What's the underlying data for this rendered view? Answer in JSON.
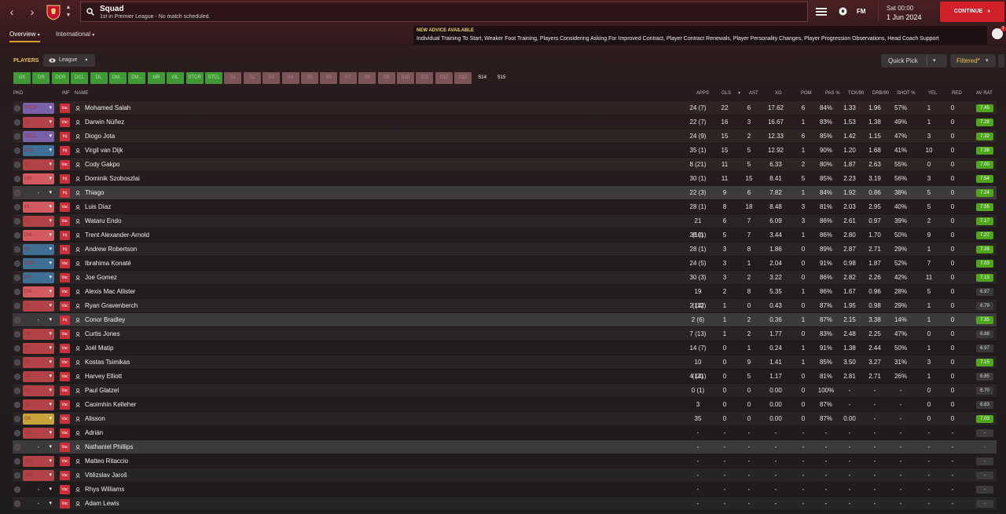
{
  "header": {
    "title": "Squad",
    "subtitle": "1st in Premier League - No match scheduled.",
    "fm_logo": "FM",
    "time": "Sat 00:00",
    "date": "1 Jun 2024",
    "continue_label": "CONTINUE"
  },
  "tabs": [
    {
      "label": "Overview"
    },
    {
      "label": "International"
    }
  ],
  "advice": {
    "heading": "NEW ADVICE AVAILABLE",
    "text": "Individual Training To Start, Weaker Foot Training, Players Considering Asking For Improved Contract, Player Contract Renewals, Player Personality Changes, Player Progression Observations, Head Coach Support"
  },
  "avatar_badge": "1",
  "filters": {
    "players_label": "PLAYERS",
    "league_label": "League",
    "quick_pick": "Quick Pick",
    "filtered": "Filtered*"
  },
  "positions": [
    "GK",
    "DR",
    "DCR",
    "DCL",
    "DL",
    "DM...",
    "DM...",
    "MR",
    "ML",
    "STCR",
    "STCL",
    "S1",
    "S2",
    "S3",
    "S4",
    "S5",
    "S6",
    "S7",
    "S8",
    "S9",
    "S10",
    "S11",
    "S12",
    "S13",
    "S14",
    "S15"
  ],
  "columns": {
    "pkd": "PKD",
    "inf": "INF",
    "name": "NAME",
    "apps": "APPS",
    "gls": "GLS",
    "ast": "AST",
    "xg": "XG",
    "pom": "POM",
    "pas": "PAS %",
    "tck": "TCK/90",
    "drb": "DRB/90",
    "shot": "SHOT %",
    "yel": "YEL",
    "red": "RED",
    "avrat": "AV RAT"
  },
  "players": [
    {
      "pos": "STCR",
      "inf": "Vac",
      "name": "Mohamed Salah",
      "apps": "24 (7)",
      "gls": "22",
      "ast": "6",
      "xg": "17.62",
      "pom": "6",
      "pas": "84%",
      "tck": "1.33",
      "drb": "1.96",
      "shot": "57%",
      "yel": "1",
      "red": "0",
      "rat": "7.45"
    },
    {
      "pos": "S2",
      "inf": "Vac",
      "name": "Darwin Núñez",
      "apps": "22 (7)",
      "gls": "16",
      "ast": "3",
      "xg": "16.67",
      "pom": "1",
      "pas": "83%",
      "tck": "1.53",
      "drb": "1.38",
      "shot": "49%",
      "yel": "1",
      "red": "0",
      "rat": "7.28"
    },
    {
      "pos": "STCL",
      "inf": "Inj",
      "name": "Diogo Jota",
      "apps": "24 (9)",
      "gls": "15",
      "ast": "2",
      "xg": "12.33",
      "pom": "6",
      "pas": "85%",
      "tck": "1.42",
      "drb": "1.15",
      "shot": "47%",
      "yel": "3",
      "red": "0",
      "rat": "7.32"
    },
    {
      "pos": "DCL",
      "inf": "Inj",
      "name": "Virgil van Dijk",
      "apps": "35 (1)",
      "gls": "15",
      "ast": "5",
      "xg": "12.92",
      "pom": "1",
      "pas": "90%",
      "tck": "1.20",
      "drb": "1.68",
      "shot": "41%",
      "yel": "10",
      "red": "0",
      "rat": "7.38"
    },
    {
      "pos": "S1",
      "inf": "Vac",
      "name": "Cody Gakpo",
      "apps": "8 (21)",
      "gls": "11",
      "ast": "5",
      "xg": "6.33",
      "pom": "2",
      "pas": "80%",
      "tck": "1.87",
      "drb": "2.63",
      "shot": "55%",
      "yel": "0",
      "red": "0",
      "rat": "7.00"
    },
    {
      "pos": "MR",
      "inf": "Inj",
      "name": "Dominik Szoboszlai",
      "apps": "30 (1)",
      "gls": "11",
      "ast": "15",
      "xg": "8.41",
      "pom": "5",
      "pas": "85%",
      "tck": "2.23",
      "drb": "3.19",
      "shot": "56%",
      "yel": "3",
      "red": "0",
      "rat": "7.54"
    },
    {
      "pos": "-",
      "inf": "Inj",
      "name": "Thiago",
      "apps": "22 (3)",
      "gls": "9",
      "ast": "6",
      "xg": "7.82",
      "pom": "1",
      "pas": "84%",
      "tck": "1.92",
      "drb": "0.86",
      "shot": "38%",
      "yel": "5",
      "red": "0",
      "rat": "7.24",
      "hl": true
    },
    {
      "pos": "ML",
      "inf": "Vac",
      "name": "Luis Díaz",
      "apps": "28 (1)",
      "gls": "8",
      "ast": "18",
      "xg": "8.48",
      "pom": "3",
      "pas": "81%",
      "tck": "2.03",
      "drb": "2.95",
      "shot": "40%",
      "yel": "5",
      "red": "0",
      "rat": "7.55"
    },
    {
      "pos": "S3",
      "inf": "Vac",
      "name": "Wataru Endo",
      "apps": "21 (10)",
      "gls": "6",
      "ast": "7",
      "xg": "6.09",
      "pom": "3",
      "pas": "86%",
      "tck": "2.61",
      "drb": "0.97",
      "shot": "39%",
      "yel": "2",
      "red": "0",
      "rat": "7.17"
    },
    {
      "pos": "DM...",
      "inf": "Inj",
      "name": "Trent Alexander-Arnold",
      "apps": "26 (1)",
      "gls": "5",
      "ast": "7",
      "xg": "3.44",
      "pom": "1",
      "pas": "86%",
      "tck": "2.80",
      "drb": "1.70",
      "shot": "50%",
      "yel": "9",
      "red": "0",
      "rat": "7.27"
    },
    {
      "pos": "DL",
      "inf": "Inj",
      "name": "Andrew Robertson",
      "apps": "28 (1)",
      "gls": "3",
      "ast": "8",
      "xg": "1.86",
      "pom": "0",
      "pas": "89%",
      "tck": "2.87",
      "drb": "2.71",
      "shot": "29%",
      "yel": "1",
      "red": "0",
      "rat": "7.28"
    },
    {
      "pos": "DCR",
      "inf": "Vac",
      "name": "Ibrahima Konaté",
      "apps": "24 (5)",
      "gls": "3",
      "ast": "1",
      "xg": "2.04",
      "pom": "0",
      "pas": "91%",
      "tck": "0.98",
      "drb": "1.87",
      "shot": "52%",
      "yel": "7",
      "red": "0",
      "rat": "7.03"
    },
    {
      "pos": "DR",
      "inf": "Vac",
      "name": "Joe Gomez",
      "apps": "30 (3)",
      "gls": "3",
      "ast": "2",
      "xg": "3.22",
      "pom": "0",
      "pas": "86%",
      "tck": "2.82",
      "drb": "2.26",
      "shot": "42%",
      "yel": "11",
      "red": "0",
      "rat": "7.13"
    },
    {
      "pos": "DM...",
      "inf": "Vac",
      "name": "Alexis Mac Allister",
      "apps": "19 (14)",
      "gls": "2",
      "ast": "8",
      "xg": "5.35",
      "pom": "1",
      "pas": "86%",
      "tck": "1.67",
      "drb": "0.96",
      "shot": "28%",
      "yel": "5",
      "red": "0",
      "rat": "6.97"
    },
    {
      "pos": "S5",
      "inf": "Vac",
      "name": "Ryan Gravenberch",
      "apps": "2 (12)",
      "gls": "1",
      "ast": "0",
      "xg": "0.43",
      "pom": "0",
      "pas": "87%",
      "tck": "1.95",
      "drb": "0.98",
      "shot": "29%",
      "yel": "1",
      "red": "0",
      "rat": "6.79"
    },
    {
      "pos": "-",
      "inf": "Inj",
      "name": "Conor Bradley",
      "apps": "2 (6)",
      "gls": "1",
      "ast": "2",
      "xg": "0.36",
      "pom": "1",
      "pas": "87%",
      "tck": "2.15",
      "drb": "3.38",
      "shot": "14%",
      "yel": "1",
      "red": "0",
      "rat": "7.35",
      "hl": true
    },
    {
      "pos": "S6",
      "inf": "Vac",
      "name": "Curtis Jones",
      "apps": "7 (13)",
      "gls": "1",
      "ast": "2",
      "xg": "1.77",
      "pom": "0",
      "pas": "83%",
      "tck": "2.48",
      "drb": "2.25",
      "shot": "47%",
      "yel": "0",
      "red": "0",
      "rat": "6.88"
    },
    {
      "pos": "S7",
      "inf": "Vac",
      "name": "Joël Matip",
      "apps": "14 (7)",
      "gls": "0",
      "ast": "1",
      "xg": "0.24",
      "pom": "1",
      "pas": "91%",
      "tck": "1.38",
      "drb": "2.44",
      "shot": "50%",
      "yel": "1",
      "red": "0",
      "rat": "6.97"
    },
    {
      "pos": "S8",
      "inf": "Vac",
      "name": "Kostas Tsimikas",
      "apps": "10 (14)",
      "gls": "0",
      "ast": "9",
      "xg": "1.41",
      "pom": "1",
      "pas": "85%",
      "tck": "3.50",
      "drb": "3.27",
      "shot": "31%",
      "yel": "3",
      "red": "0",
      "rat": "7.15"
    },
    {
      "pos": "S4",
      "inf": "Vac",
      "name": "Harvey Elliott",
      "apps": "4 (21)",
      "gls": "0",
      "ast": "5",
      "xg": "1.17",
      "pom": "0",
      "pas": "81%",
      "tck": "2.81",
      "drb": "2.71",
      "shot": "26%",
      "yel": "1",
      "red": "0",
      "rat": "6.95"
    },
    {
      "pos": "S10",
      "inf": "Vac",
      "name": "Paul Glatzel",
      "apps": "0 (1)",
      "gls": "0",
      "ast": "0",
      "xg": "0.00",
      "pom": "0",
      "pas": "100%",
      "tck": "-",
      "drb": "-",
      "shot": "-",
      "yel": "0",
      "red": "0",
      "rat": "6.70"
    },
    {
      "pos": "S9",
      "inf": "Vac",
      "name": "Caoimhin Kelleher",
      "apps": "3",
      "gls": "0",
      "ast": "0",
      "xg": "0.00",
      "pom": "0",
      "pas": "87%",
      "tck": "-",
      "drb": "-",
      "shot": "-",
      "yel": "0",
      "red": "0",
      "rat": "6.83"
    },
    {
      "pos": "GK",
      "inf": "Vac",
      "name": "Alisson",
      "apps": "35",
      "gls": "0",
      "ast": "0",
      "xg": "0.00",
      "pom": "0",
      "pas": "87%",
      "tck": "0.00",
      "drb": "-",
      "shot": "-",
      "yel": "0",
      "red": "0",
      "rat": "7.03"
    },
    {
      "pos": "S11",
      "inf": "Vac",
      "name": "Adrián",
      "apps": "-",
      "gls": "-",
      "ast": "-",
      "xg": "-",
      "pom": "-",
      "pas": "-",
      "tck": "-",
      "drb": "-",
      "shot": "-",
      "yel": "-",
      "red": "-",
      "rat": "-"
    },
    {
      "pos": "-",
      "inf": "Vac",
      "name": "Nathaniel Phillips",
      "apps": "-",
      "gls": "-",
      "ast": "-",
      "xg": "-",
      "pom": "-",
      "pas": "-",
      "tck": "-",
      "drb": "-",
      "shot": "-",
      "yel": "-",
      "red": "-",
      "rat": "-",
      "hl": true
    },
    {
      "pos": "S12",
      "inf": "Vac",
      "name": "Matteo Ritaccio",
      "apps": "-",
      "gls": "-",
      "ast": "-",
      "xg": "-",
      "pom": "-",
      "pas": "-",
      "tck": "-",
      "drb": "-",
      "shot": "-",
      "yel": "-",
      "red": "-",
      "rat": "-"
    },
    {
      "pos": "S13",
      "inf": "Vac",
      "name": "Vitězslav Jaroš",
      "apps": "-",
      "gls": "-",
      "ast": "-",
      "xg": "-",
      "pom": "-",
      "pas": "-",
      "tck": "-",
      "drb": "-",
      "shot": "-",
      "yel": "-",
      "red": "-",
      "rat": "-"
    },
    {
      "pos": "-",
      "inf": "Vac",
      "name": "Rhys Williams",
      "apps": "-",
      "gls": "-",
      "ast": "-",
      "xg": "-",
      "pom": "-",
      "pas": "-",
      "tck": "-",
      "drb": "-",
      "shot": "-",
      "yel": "-",
      "red": "-",
      "rat": "-"
    },
    {
      "pos": "-",
      "inf": "Vac",
      "name": "Adam Lewis",
      "apps": "-",
      "gls": "-",
      "ast": "-",
      "xg": "-",
      "pom": "-",
      "pas": "-",
      "tck": "-",
      "drb": "-",
      "shot": "-",
      "yel": "-",
      "red": "-",
      "rat": "-"
    }
  ],
  "colors": {
    "continue": "#d2202a",
    "accent": "#e9c24a",
    "rating_green": "#4fa61c",
    "gk": "#c8a23a",
    "defence": "#3f6f94",
    "midfield": "#d25a60",
    "attack": "#7a60a8",
    "subs": "#b24248",
    "pos_green": "#3f9a36",
    "pos_slot": "#7a5457"
  }
}
